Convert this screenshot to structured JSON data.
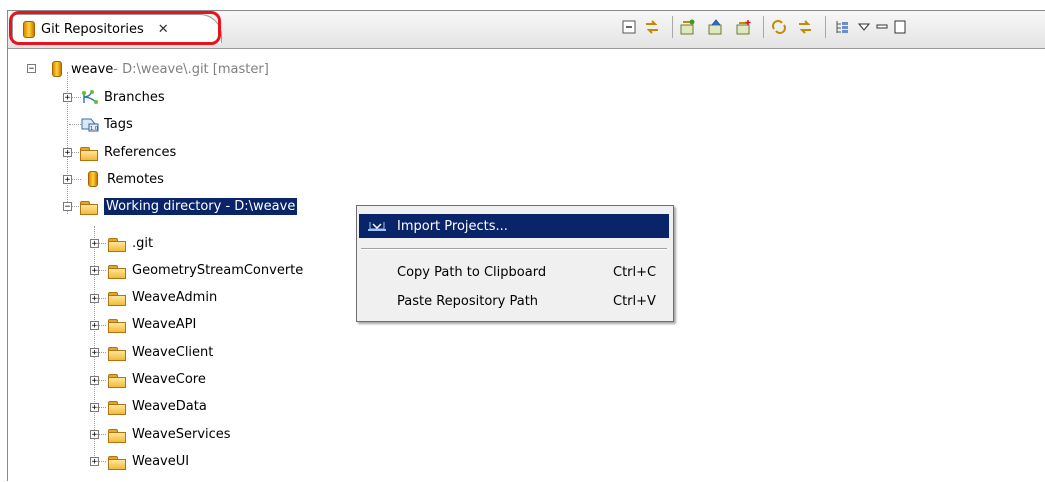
{
  "view": {
    "tab_label": "Git Repositories",
    "tab_close_glyph": "✕",
    "tab_icon": "repository-icon",
    "tab_highlight_color": "#e8131c"
  },
  "toolbar": {
    "icons": [
      "collapse-all-icon",
      "link-with-editor-icon",
      "add-repository-icon",
      "clone-repository-icon",
      "create-repository-icon",
      "refresh-icon",
      "link-icon",
      "tree-layout-icon",
      "view-menu-icon",
      "minimize-icon",
      "maximize-icon"
    ]
  },
  "tree": {
    "repo_name": "weave",
    "repo_path": " - D:\\weave\\.git [master]",
    "branches": "Branches",
    "tags": "Tags",
    "references": "References",
    "remotes": "Remotes",
    "working_dir": "Working directory - D:\\weave",
    "children": [
      ".git",
      "GeometryStreamConverte",
      "WeaveAdmin",
      "WeaveAPI",
      "WeaveClient",
      "WeaveCore",
      "WeaveData",
      "WeaveServices",
      "WeaveUI"
    ]
  },
  "context_menu": {
    "import": "Import Projects...",
    "copy_path": "Copy Path to Clipboard",
    "copy_shortcut": "Ctrl+C",
    "paste_path": "Paste Repository Path",
    "paste_shortcut": "Ctrl+V",
    "selection_color": "#0a246a"
  }
}
